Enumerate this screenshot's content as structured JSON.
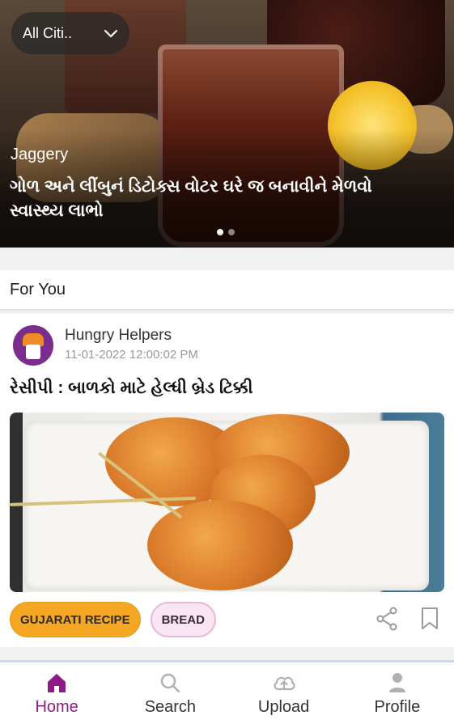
{
  "hero": {
    "city_selector": "All Citi..",
    "tag": "Jaggery",
    "title": "ગોળ અને લીંબુનં ડિટોક્સ વોટર ઘરે જ બનાવીને મેળવો સ્વાસ્થ્ય લાભો",
    "slides_total": 2,
    "slide_active": 1
  },
  "section": {
    "title": "For You"
  },
  "post": {
    "author": "Hungry Helpers",
    "datetime": "11-01-2022 12:00:02 PM",
    "title": "રેસીપી : બાળકો માટે હેલ્ધી બ્રેડ ટિક્કી",
    "tags": [
      "GUJARATI RECIPE",
      "BREAD"
    ]
  },
  "nav": {
    "items": [
      {
        "label": "Home",
        "icon": "home-icon",
        "active": true
      },
      {
        "label": "Search",
        "icon": "search-icon",
        "active": false
      },
      {
        "label": "Upload",
        "icon": "cloud-upload-icon",
        "active": false
      },
      {
        "label": "Profile",
        "icon": "person-icon",
        "active": false
      }
    ]
  },
  "colors": {
    "accent": "#8e1a87",
    "tag_orange": "#f5a623",
    "tag_pink": "#fbe5f3"
  }
}
